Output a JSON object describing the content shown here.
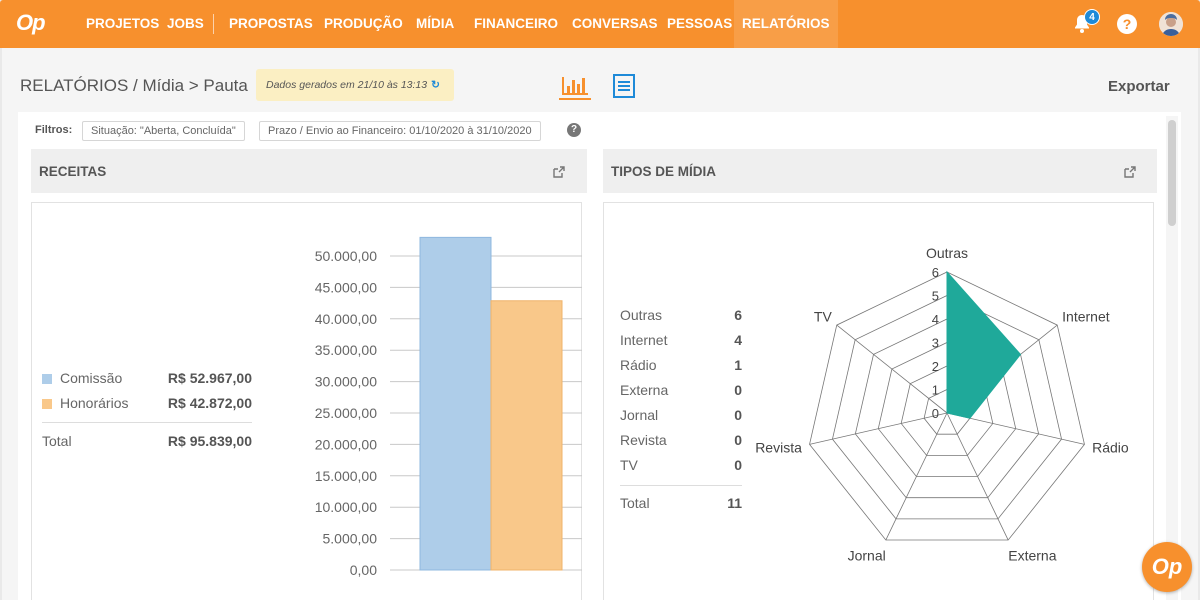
{
  "app": {
    "logo_text": "Op"
  },
  "nav": {
    "items": [
      {
        "label": "PROJETOS"
      },
      {
        "label": "JOBS"
      },
      {
        "label": "PROPOSTAS"
      },
      {
        "label": "PRODUÇÃO"
      },
      {
        "label": "MÍDIA"
      },
      {
        "label": "FINANCEIRO"
      },
      {
        "label": "CONVERSAS"
      },
      {
        "label": "PESSOAS"
      },
      {
        "label": "RELATÓRIOS",
        "active": true
      }
    ],
    "notification_count": "4",
    "help_label": "?"
  },
  "header": {
    "breadcrumb": "RELATÓRIOS / Mídia > Pauta",
    "generated_text": "Dados gerados em 21/10 às 13:13",
    "refresh_icon": "↻",
    "export_label": "Exportar"
  },
  "filters": {
    "label": "Filtros:",
    "chips": [
      "Situação: \"Aberta, Concluída\"",
      "Prazo / Envio ao Financeiro: 01/10/2020 à 31/10/2020"
    ],
    "help": "?"
  },
  "receitas": {
    "title": "RECEITAS",
    "legend": [
      {
        "name": "Comissão",
        "value": "R$ 52.967,00",
        "color": "#aecde9"
      },
      {
        "name": "Honorários",
        "value": "R$ 42.872,00",
        "color": "#f9c88a"
      }
    ],
    "total_label": "Total",
    "total_value": "R$ 95.839,00"
  },
  "tipos": {
    "title": "TIPOS DE MÍDIA",
    "rows": [
      {
        "name": "Outras",
        "value": "6"
      },
      {
        "name": "Internet",
        "value": "4"
      },
      {
        "name": "Rádio",
        "value": "1"
      },
      {
        "name": "Externa",
        "value": "0"
      },
      {
        "name": "Jornal",
        "value": "0"
      },
      {
        "name": "Revista",
        "value": "0"
      },
      {
        "name": "TV",
        "value": "0"
      }
    ],
    "total_label": "Total",
    "total_value": "11"
  },
  "chart_data": [
    {
      "type": "bar",
      "categories": [
        "Comissão",
        "Honorários"
      ],
      "values": [
        52967,
        42872
      ],
      "colors": [
        "#aecde9",
        "#f9c88a"
      ],
      "ylim": [
        0,
        50000
      ],
      "yticks": [
        "0,00",
        "5.000,00",
        "10.000,00",
        "15.000,00",
        "20.000,00",
        "25.000,00",
        "30.000,00",
        "35.000,00",
        "40.000,00",
        "45.000,00",
        "50.000,00"
      ],
      "grid": true
    },
    {
      "type": "radar",
      "axes": [
        "Outras",
        "Internet",
        "Rádio",
        "Externa",
        "Jornal",
        "Revista",
        "TV"
      ],
      "values": [
        6,
        4,
        1,
        0,
        0,
        0,
        0
      ],
      "rlim": [
        0,
        6
      ],
      "rticks": [
        "0",
        "1",
        "2",
        "3",
        "4",
        "5",
        "6"
      ],
      "fill_color": "#1fa99a"
    }
  ],
  "fab_label": "Op"
}
